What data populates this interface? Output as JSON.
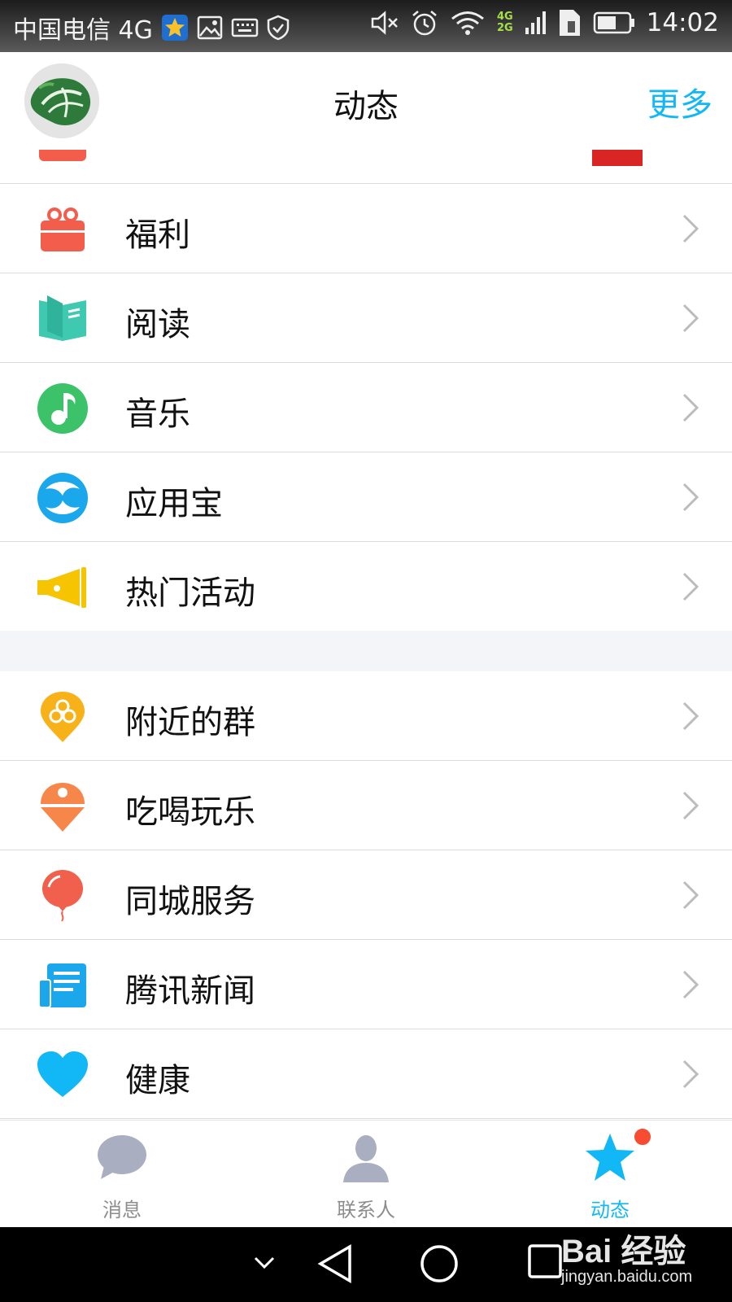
{
  "status_bar": {
    "carrier": "中国电信 4G",
    "net_4g": "4G",
    "net_2g": "2G",
    "time": "14:02"
  },
  "header": {
    "title": "动态",
    "more_label": "更多"
  },
  "list": {
    "items": [
      {
        "label": "福利",
        "icon": "gift-icon",
        "color": "#f25e4b"
      },
      {
        "label": "阅读",
        "icon": "book-icon",
        "color": "#3fc9b0"
      },
      {
        "label": "音乐",
        "icon": "music-note-icon",
        "color": "#3cc36a"
      },
      {
        "label": "应用宝",
        "icon": "app-store-icon",
        "color": "#1aa7ec"
      },
      {
        "label": "热门活动",
        "icon": "megaphone-icon",
        "color": "#f6c400"
      },
      {
        "label": "附近的群",
        "icon": "location-group-icon",
        "color": "#f7b21a"
      },
      {
        "label": "吃喝玩乐",
        "icon": "ice-cream-icon",
        "color": "#f6864a"
      },
      {
        "label": "同城服务",
        "icon": "balloon-icon",
        "color": "#f0604d"
      },
      {
        "label": "腾讯新闻",
        "icon": "newspaper-icon",
        "color": "#1aa7ec"
      },
      {
        "label": "健康",
        "icon": "heart-icon",
        "color": "#12b7f5"
      }
    ]
  },
  "tab_bar": {
    "tabs": [
      {
        "label": "消息",
        "icon": "chat-bubble-icon"
      },
      {
        "label": "联系人",
        "icon": "contacts-icon"
      },
      {
        "label": "动态",
        "icon": "star-icon",
        "active": true
      }
    ]
  },
  "watermark": {
    "brand": "Bai 经验",
    "url": "jingyan.baidu.com"
  },
  "colors": {
    "accent": "#12b7f5",
    "separator": "#dcdcdc",
    "badge": "#f74c31"
  }
}
